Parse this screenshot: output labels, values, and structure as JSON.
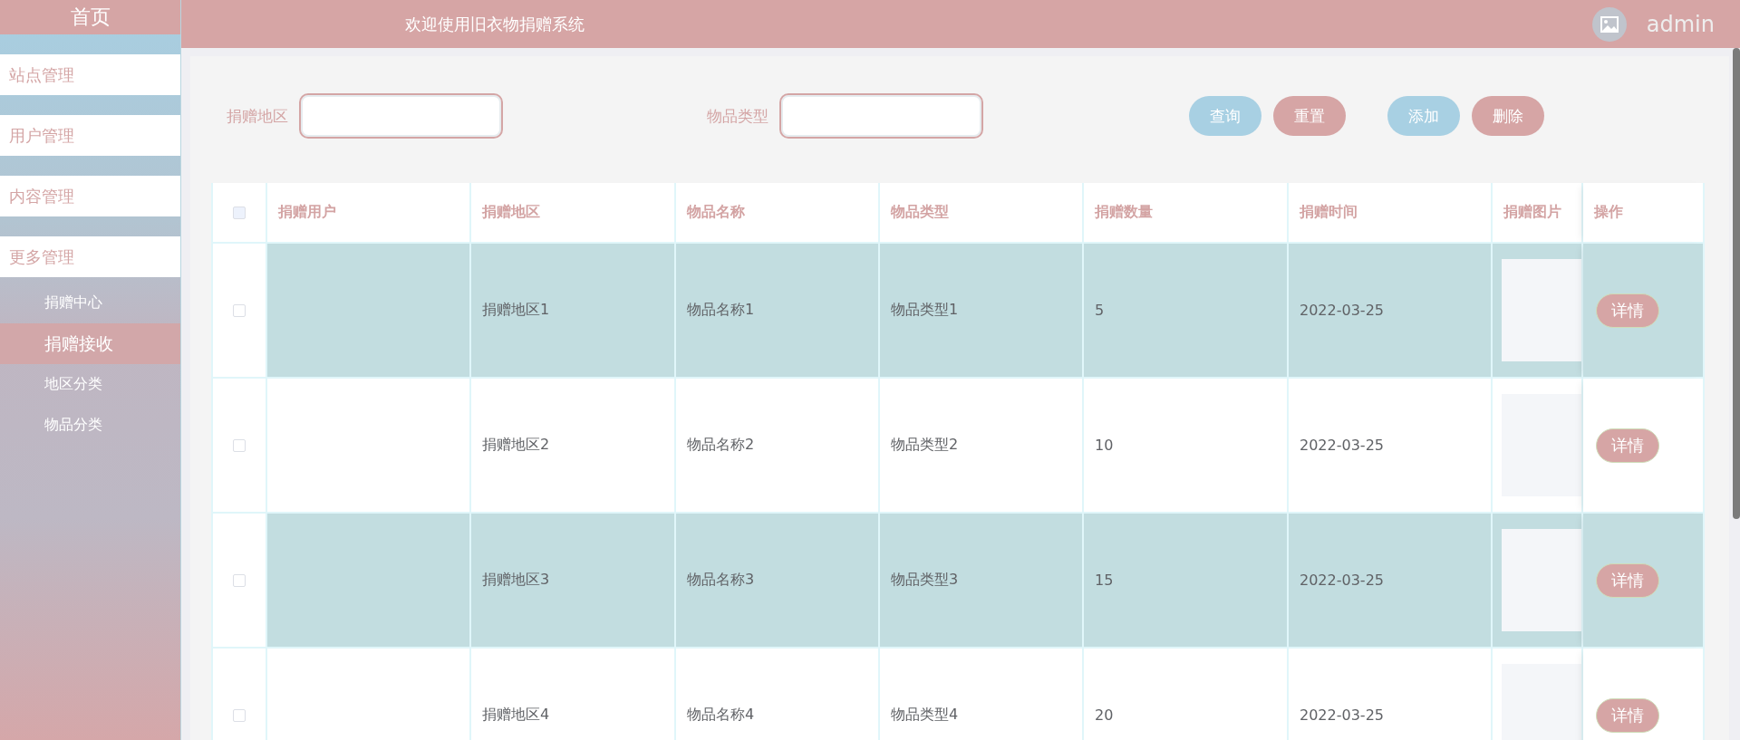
{
  "header": {
    "title": "欢迎使用旧衣物捐赠系统",
    "username": "admin"
  },
  "sidebar": {
    "home": "首页",
    "menus": [
      {
        "label": "站点管理"
      },
      {
        "label": "用户管理"
      },
      {
        "label": "内容管理"
      },
      {
        "label": "更多管理",
        "children": [
          {
            "label": "捐赠中心",
            "selected": false
          },
          {
            "label": "捐赠接收",
            "selected": true
          },
          {
            "label": "地区分类",
            "selected": false
          },
          {
            "label": "物品分类",
            "selected": false
          }
        ]
      }
    ]
  },
  "filters": [
    {
      "label": "捐赠地区"
    },
    {
      "label": "物品类型"
    }
  ],
  "buttons": [
    {
      "label": "查询",
      "kind": "primary"
    },
    {
      "label": "重置",
      "kind": "danger"
    },
    {
      "label": "添加",
      "kind": "primary"
    },
    {
      "label": "删除",
      "kind": "danger"
    }
  ],
  "table": {
    "select_all": {
      "checked": false
    },
    "columns": [
      "捐赠用户",
      "捐赠地区",
      "物品名称",
      "物品类型",
      "捐赠数量",
      "捐赠时间",
      "捐赠图片",
      "操作"
    ],
    "rows": [
      {
        "checked": false,
        "region": "捐赠地区1",
        "name": "物品名称1",
        "type": "物品类型1",
        "quantity": "5",
        "time": "2022-03-25",
        "action": "详情"
      },
      {
        "checked": false,
        "region": "捐赠地区2",
        "name": "物品名称2",
        "type": "物品类型2",
        "quantity": "10",
        "time": "2022-03-25",
        "action": "详情"
      },
      {
        "checked": false,
        "region": "捐赠地区3",
        "name": "物品名称3",
        "type": "物品类型3",
        "quantity": "15",
        "time": "2022-03-25",
        "action": "详情"
      },
      {
        "checked": false,
        "region": "捐赠地区4",
        "name": "物品名称4",
        "type": "物品类型4",
        "quantity": "20",
        "time": "2022-03-25",
        "action": "详情"
      }
    ]
  }
}
